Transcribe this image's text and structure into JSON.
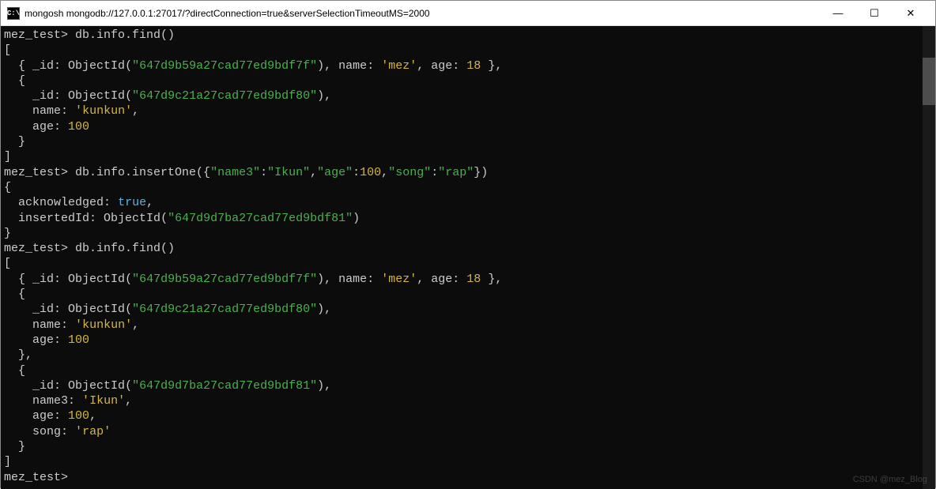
{
  "window": {
    "title": "mongosh mongodb://127.0.0.1:27017/?directConnection=true&serverSelectionTimeoutMS=2000",
    "icon_label": "C:\\",
    "min": "—",
    "max": "☐",
    "close": "✕"
  },
  "colors": {
    "bg": "#0c0c0c",
    "fg": "#cccccc",
    "string_green": "#4caf50",
    "string_yellow": "#d4b642",
    "number": "#d4b642",
    "bool": "#5fb0df"
  },
  "prompt": "mez_test>",
  "commands": {
    "find1": "db.info.find()",
    "insert": "db.info.insertOne({\"name3\":\"Ikun\",\"age\":100,\"song\":\"rap\"})",
    "find2": "db.info.find()"
  },
  "find1_result": [
    {
      "_id": "647d9b59a27cad77ed9bdf7f",
      "name": "mez",
      "age": 18
    },
    {
      "_id": "647d9c21a27cad77ed9bdf80",
      "name": "kunkun",
      "age": 100
    }
  ],
  "insert_result": {
    "acknowledged": true,
    "insertedId": "647d9d7ba27cad77ed9bdf81"
  },
  "find2_result": [
    {
      "_id": "647d9b59a27cad77ed9bdf7f",
      "name": "mez",
      "age": 18
    },
    {
      "_id": "647d9c21a27cad77ed9bdf80",
      "name": "kunkun",
      "age": 100
    },
    {
      "_id": "647d9d7ba27cad77ed9bdf81",
      "name3": "Ikun",
      "age": 100,
      "song": "rap"
    }
  ],
  "insert_tokens": {
    "name3_key": "\"name3\"",
    "name3_val": "\"Ikun\"",
    "age_key": "\"age\"",
    "age_val": "100",
    "song_key": "\"song\"",
    "song_val": "\"rap\""
  },
  "labels": {
    "id": "_id",
    "oid": "ObjectId",
    "name": "name",
    "name3": "name3",
    "age": "age",
    "song": "song",
    "ack": "acknowledged",
    "ins": "insertedId",
    "true": "true"
  },
  "watermark": "CSDN @mez_Blog"
}
